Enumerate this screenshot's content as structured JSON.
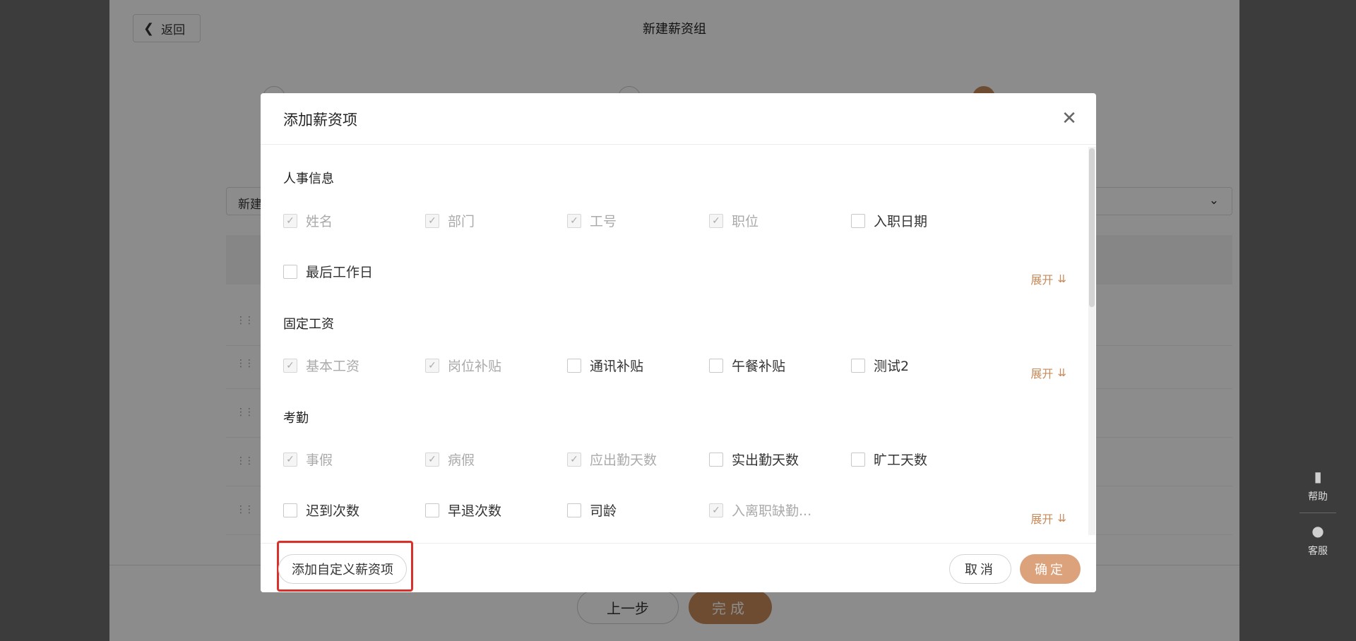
{
  "background": {
    "back_label": "返回",
    "page_title": "新建薪资组",
    "select_text": "新建",
    "prev_label": "上一步",
    "done_label": "完成"
  },
  "side_widget": {
    "help_label": "帮助",
    "service_label": "客服"
  },
  "modal": {
    "title": "添加薪资项",
    "expand_label": "展开",
    "sections": [
      {
        "title": "人事信息",
        "items": [
          {
            "label": "姓名",
            "checked": true,
            "disabled": true
          },
          {
            "label": "部门",
            "checked": true,
            "disabled": true
          },
          {
            "label": "工号",
            "checked": true,
            "disabled": true
          },
          {
            "label": "职位",
            "checked": true,
            "disabled": true
          },
          {
            "label": "入职日期",
            "checked": false,
            "disabled": false
          },
          {
            "label": "最后工作日",
            "checked": false,
            "disabled": false
          }
        ]
      },
      {
        "title": "固定工资",
        "items": [
          {
            "label": "基本工资",
            "checked": true,
            "disabled": true
          },
          {
            "label": "岗位补贴",
            "checked": true,
            "disabled": true
          },
          {
            "label": "通讯补贴",
            "checked": false,
            "disabled": false
          },
          {
            "label": "午餐补贴",
            "checked": false,
            "disabled": false
          },
          {
            "label": "测试2",
            "checked": false,
            "disabled": false
          }
        ]
      },
      {
        "title": "考勤",
        "items": [
          {
            "label": "事假",
            "checked": true,
            "disabled": true
          },
          {
            "label": "病假",
            "checked": true,
            "disabled": true
          },
          {
            "label": "应出勤天数",
            "checked": true,
            "disabled": true
          },
          {
            "label": "实出勤天数",
            "checked": false,
            "disabled": false
          },
          {
            "label": "旷工天数",
            "checked": false,
            "disabled": false
          },
          {
            "label": "迟到次数",
            "checked": false,
            "disabled": false
          },
          {
            "label": "早退次数",
            "checked": false,
            "disabled": false
          },
          {
            "label": "司龄",
            "checked": false,
            "disabled": false
          },
          {
            "label": "入离职缺勤...",
            "checked": true,
            "disabled": true
          }
        ]
      }
    ],
    "footer": {
      "custom_label": "添加自定义薪资项",
      "cancel_label": "取消",
      "ok_label": "确定"
    }
  }
}
